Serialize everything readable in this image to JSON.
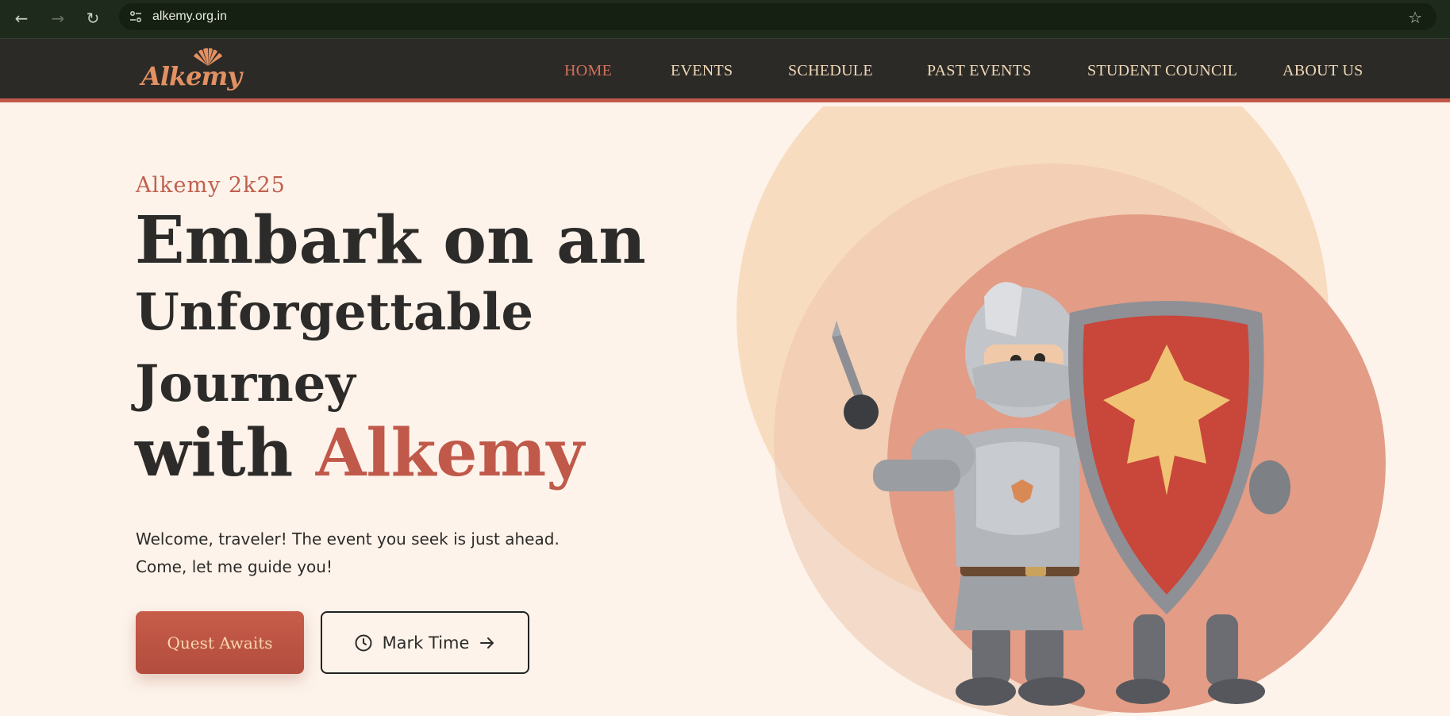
{
  "browser": {
    "url": "alkemy.org.in",
    "icons": {
      "back": "back-arrow-icon",
      "forward": "forward-arrow-icon",
      "reload": "reload-icon",
      "site_info": "tune-icon",
      "bookmark": "star-icon"
    }
  },
  "site": {
    "logo_text": "Alkemy",
    "menu": [
      {
        "label": "HOME",
        "active": true
      },
      {
        "label": "EVENTS",
        "active": false
      },
      {
        "label": "SCHEDULE",
        "active": false
      },
      {
        "label": "PAST EVENTS",
        "active": false
      },
      {
        "label": "STUDENT COUNCIL",
        "active": false
      },
      {
        "label": "ABOUT US",
        "active": false
      }
    ]
  },
  "hero": {
    "eyebrow": "Alkemy 2k25",
    "line1": "Embark on an",
    "line2": "Unforgettable",
    "line3": "Journey",
    "line4_prefix": "with ",
    "line4_accent": "Alkemy",
    "intro_line1": "Welcome, traveler! The event you seek is just ahead.",
    "intro_line2": "Come, let me guide you!",
    "primary_button": "Quest Awaits",
    "secondary_button": "Mark Time",
    "secondary_icons": {
      "left": "clock-icon",
      "right": "arrow-right-icon"
    },
    "illustration": "knight-with-shield"
  },
  "colors": {
    "accent": "#c0594a",
    "nav_bg": "#2b2a27",
    "page_bg": "#fdf3ea",
    "nav_text": "#f0d8b6"
  }
}
